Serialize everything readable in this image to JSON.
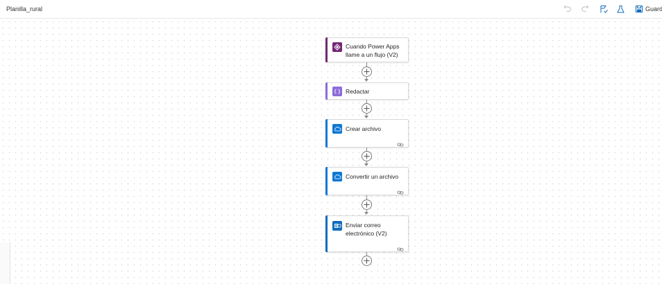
{
  "header": {
    "title": "Planilla_rural",
    "save_label": "Guard",
    "icons": [
      "undo-icon",
      "redo-icon",
      "flow-checker-icon",
      "test-icon",
      "save-icon"
    ]
  },
  "colors": {
    "powerapps_purple": "#742774",
    "compose_purple": "#8c6cd9",
    "onedrive_blue": "#0f78d4",
    "outlook_blue": "#0f6cbd"
  },
  "flow": {
    "steps": [
      {
        "label": "Cuando Power Apps llame a un flujo (V2)",
        "icon": "powerapps-icon",
        "has_link": false
      },
      {
        "label": "Redactar",
        "icon": "compose-icon",
        "has_link": false
      },
      {
        "label": "Crear archivo",
        "icon": "onedrive-icon",
        "has_link": true
      },
      {
        "label": "Convertir un archivo",
        "icon": "onedrive-icon",
        "has_link": true
      },
      {
        "label": "Enviar correo electrónico (V2)",
        "icon": "outlook-icon",
        "has_link": true
      }
    ]
  }
}
